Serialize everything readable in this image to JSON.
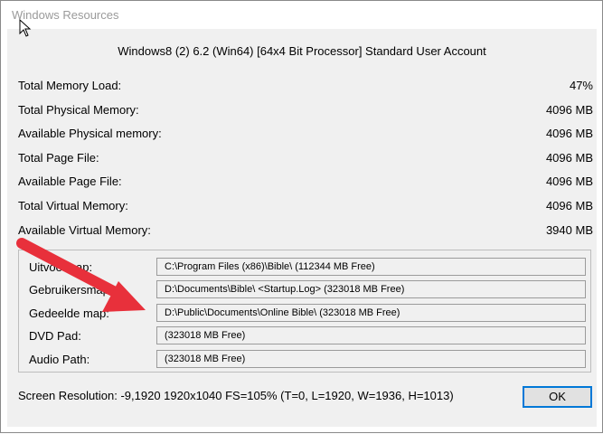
{
  "window": {
    "title": "Windows Resources",
    "header": "Windows8 (2) 6.2 (Win64) [64x4 Bit Processor] Standard User Account"
  },
  "memory": {
    "rows": [
      {
        "label": "Total Memory Load:",
        "value": "47%"
      },
      {
        "label": "Total Physical Memory:",
        "value": "4096 MB"
      },
      {
        "label": "Available Physical memory:",
        "value": "4096 MB"
      },
      {
        "label": "Total Page File:",
        "value": "4096 MB"
      },
      {
        "label": "Available Page File:",
        "value": "4096 MB"
      },
      {
        "label": "Total Virtual Memory:",
        "value": "4096 MB"
      },
      {
        "label": "Available Virtual Memory:",
        "value": "3940 MB"
      }
    ]
  },
  "paths": {
    "rows": [
      {
        "label": "Uitvoermap:",
        "value": "C:\\Program Files (x86)\\Bible\\  (112344 MB Free)"
      },
      {
        "label": "Gebruikersmap:",
        "value": "D:\\Documents\\Bible\\ <Startup.Log>  (323018 MB Free)"
      },
      {
        "label": "Gedeelde map:",
        "value": "D:\\Public\\Documents\\Online Bible\\  (323018 MB Free)"
      },
      {
        "label": "DVD Pad:",
        "value": " (323018 MB Free)"
      },
      {
        "label": "Audio Path:",
        "value": " (323018 MB Free)"
      }
    ]
  },
  "screen": {
    "resolution": "Screen Resolution:  -9,1920 1920x1040 FS=105% (T=0, L=1920, W=1936, H=1013)"
  },
  "buttons": {
    "ok": "OK"
  },
  "colors": {
    "arrow": "#e8303b",
    "dialog_bg": "#f0f0f0",
    "focus_border": "#0078d7"
  },
  "icons": {
    "cursor": "mouse-pointer-icon",
    "arrow": "red-annotation-arrow"
  }
}
